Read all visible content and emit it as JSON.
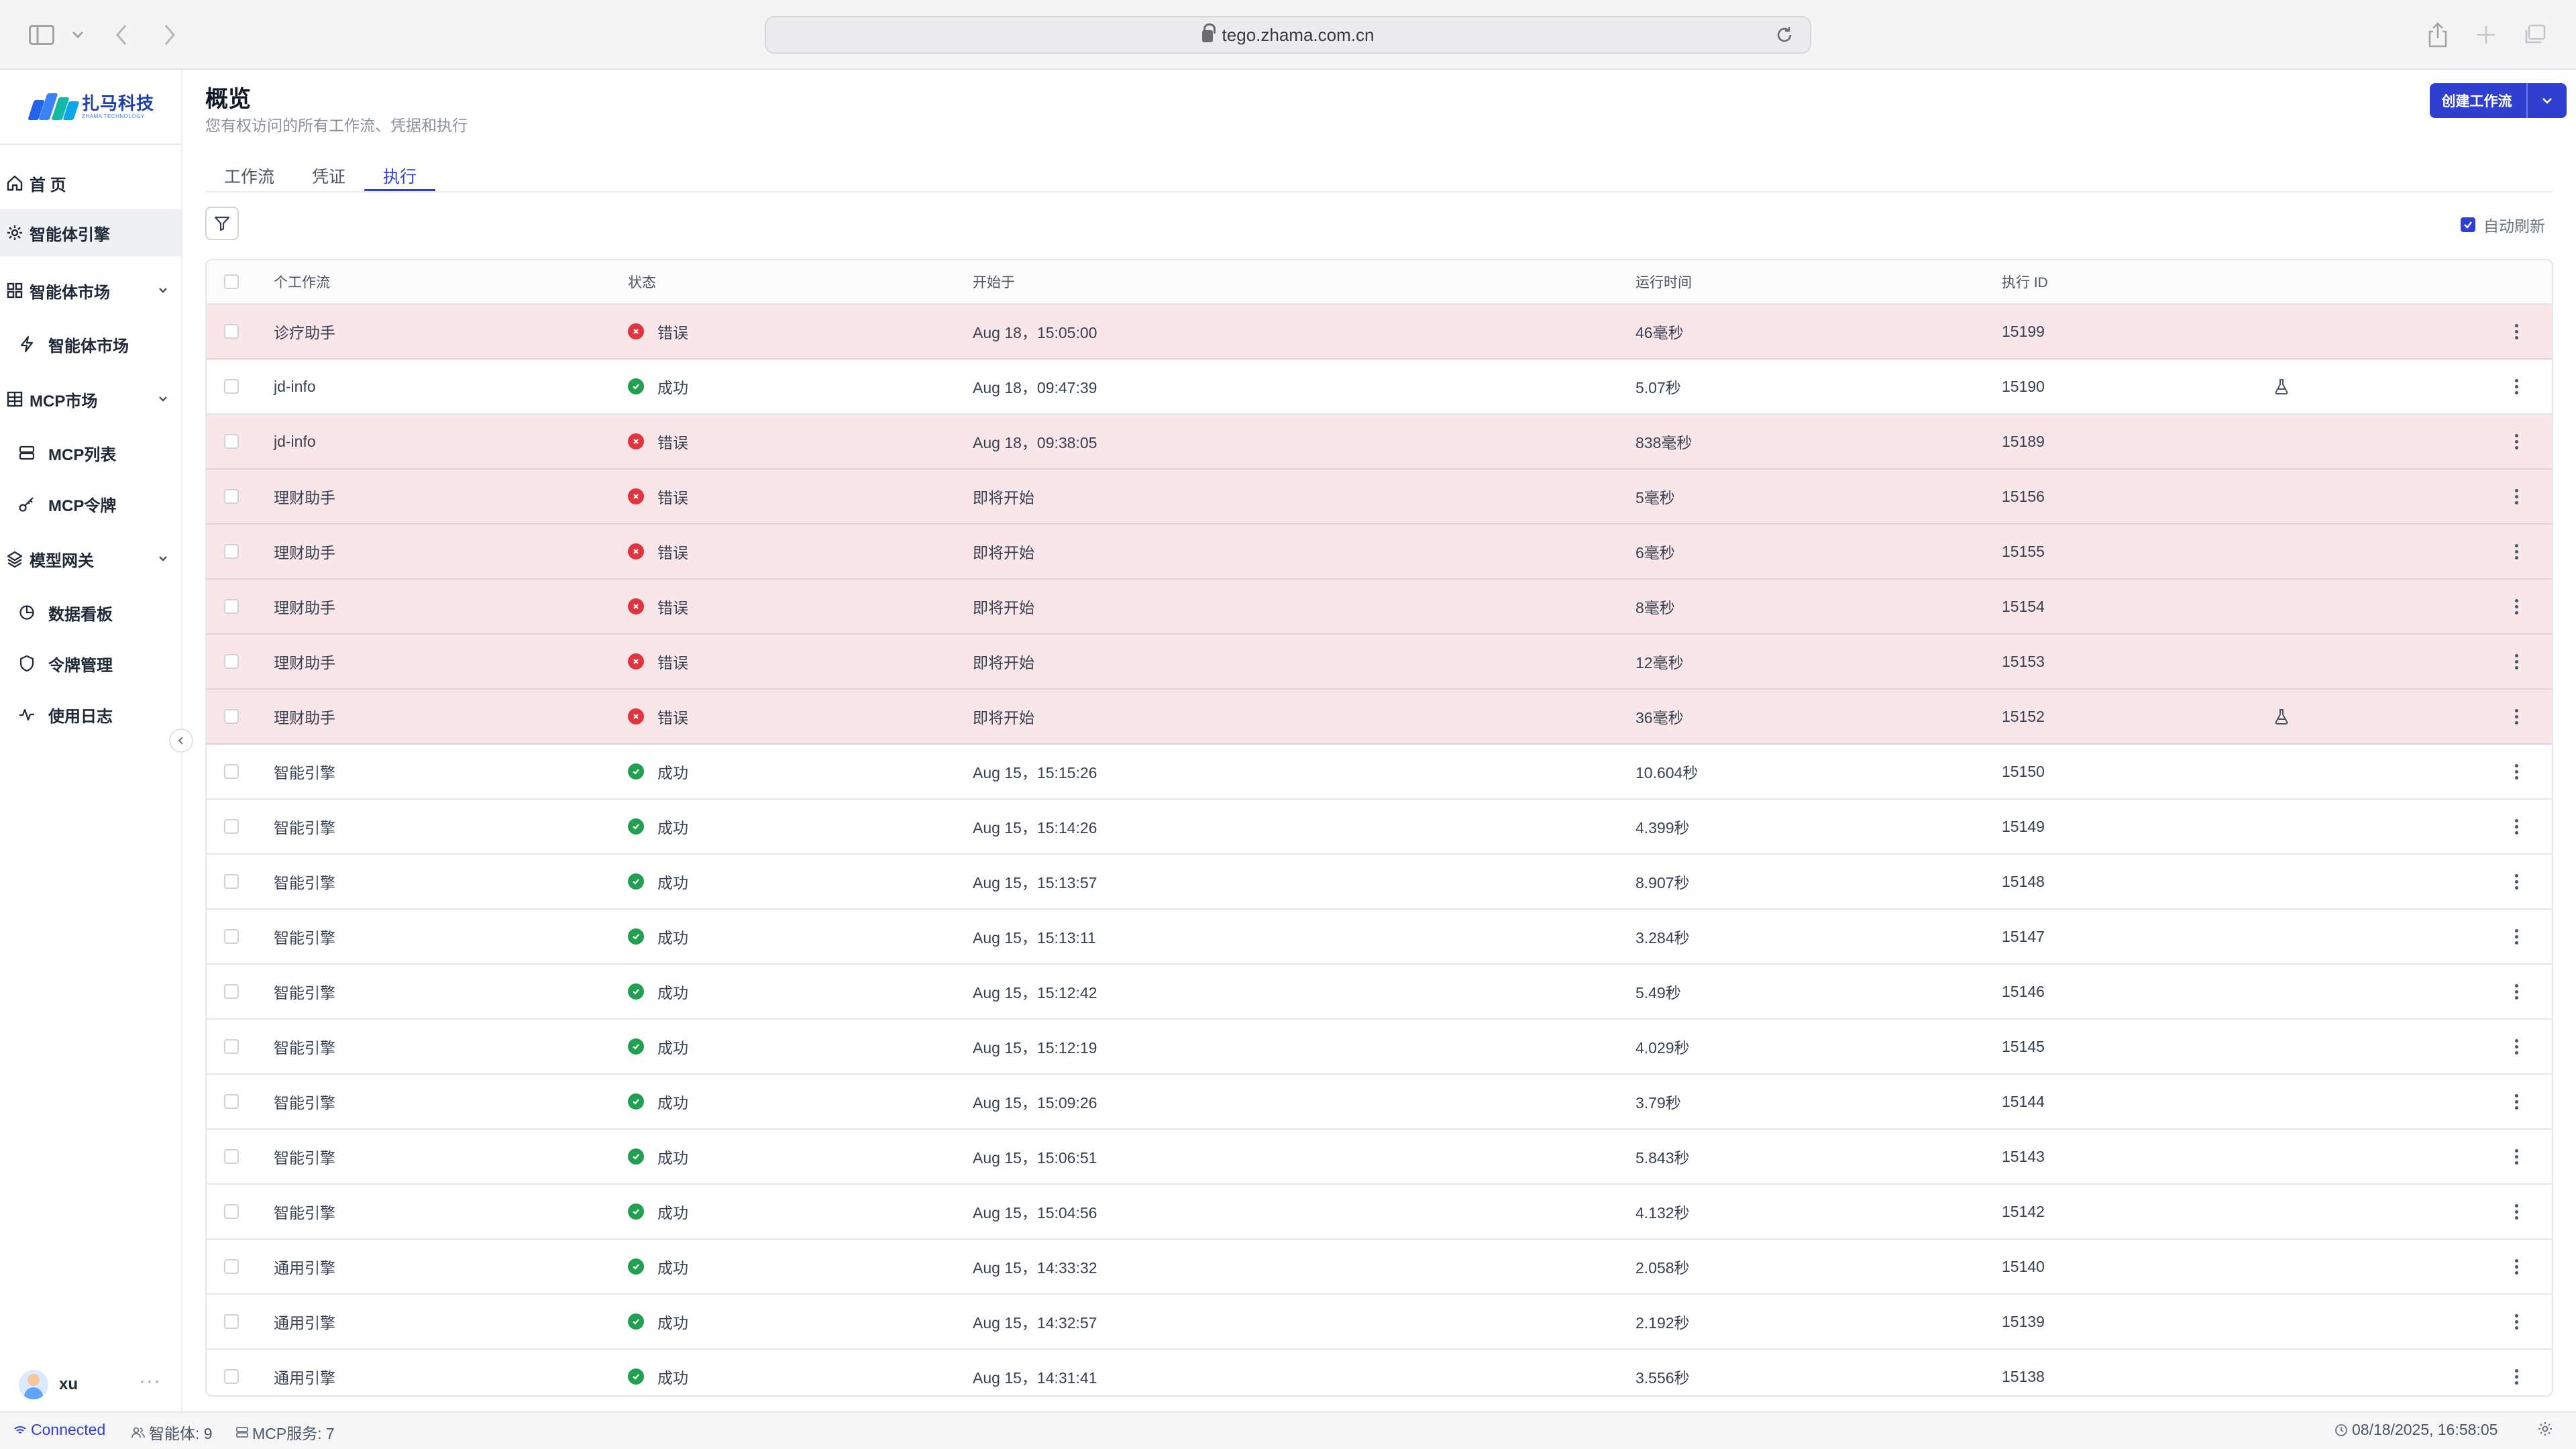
{
  "browser": {
    "url": "tego.zhama.com.cn"
  },
  "sidebar": {
    "logo_cn": "扎马科技",
    "logo_en": "ZHAMA TECHNOLOGY",
    "items": [
      {
        "label": "首 页",
        "icon": "home-icon"
      },
      {
        "label": "智能体引擎",
        "icon": "cube-gear-icon"
      },
      {
        "label": "智能体市场",
        "icon": "grid-icon"
      },
      {
        "label": "智能体市场",
        "icon": "lightning-icon"
      },
      {
        "label": "MCP市场",
        "icon": "building-icon"
      },
      {
        "label": "MCP列表",
        "icon": "server-icon"
      },
      {
        "label": "MCP令牌",
        "icon": "key-icon"
      },
      {
        "label": "模型网关",
        "icon": "layers-icon"
      },
      {
        "label": "数据看板",
        "icon": "pie-chart-icon"
      },
      {
        "label": "令牌管理",
        "icon": "shield-icon"
      },
      {
        "label": "使用日志",
        "icon": "activity-icon"
      }
    ],
    "user": {
      "name": "xu",
      "more": "···"
    }
  },
  "header": {
    "title": "概览",
    "subtitle": "您有权访问的所有工作流、凭据和执行",
    "create_button": "创建工作流"
  },
  "tabs": [
    {
      "label": "工作流",
      "active": false
    },
    {
      "label": "凭证",
      "active": false
    },
    {
      "label": "执行",
      "active": true
    }
  ],
  "toolbar": {
    "auto_refresh_label": "自动刷新",
    "auto_refresh_checked": true
  },
  "table": {
    "columns": [
      "个工作流",
      "状态",
      "开始于",
      "运行时间",
      "执行 ID"
    ],
    "rows": [
      {
        "workflow": "诊疗助手",
        "status": "错误",
        "ok": false,
        "started": "Aug 18，15:05:00",
        "runtime": "46毫秒",
        "id": "15199",
        "flask": false
      },
      {
        "workflow": "jd-info",
        "status": "成功",
        "ok": true,
        "started": "Aug 18，09:47:39",
        "runtime": "5.07秒",
        "id": "15190",
        "flask": true
      },
      {
        "workflow": "jd-info",
        "status": "错误",
        "ok": false,
        "started": "Aug 18，09:38:05",
        "runtime": "838毫秒",
        "id": "15189",
        "flask": false
      },
      {
        "workflow": "理财助手",
        "status": "错误",
        "ok": false,
        "started": "即将开始",
        "runtime": "5毫秒",
        "id": "15156",
        "flask": false
      },
      {
        "workflow": "理财助手",
        "status": "错误",
        "ok": false,
        "started": "即将开始",
        "runtime": "6毫秒",
        "id": "15155",
        "flask": false
      },
      {
        "workflow": "理财助手",
        "status": "错误",
        "ok": false,
        "started": "即将开始",
        "runtime": "8毫秒",
        "id": "15154",
        "flask": false
      },
      {
        "workflow": "理财助手",
        "status": "错误",
        "ok": false,
        "started": "即将开始",
        "runtime": "12毫秒",
        "id": "15153",
        "flask": false
      },
      {
        "workflow": "理财助手",
        "status": "错误",
        "ok": false,
        "started": "即将开始",
        "runtime": "36毫秒",
        "id": "15152",
        "flask": true
      },
      {
        "workflow": "智能引擎",
        "status": "成功",
        "ok": true,
        "started": "Aug 15，15:15:26",
        "runtime": "10.604秒",
        "id": "15150",
        "flask": false
      },
      {
        "workflow": "智能引擎",
        "status": "成功",
        "ok": true,
        "started": "Aug 15，15:14:26",
        "runtime": "4.399秒",
        "id": "15149",
        "flask": false
      },
      {
        "workflow": "智能引擎",
        "status": "成功",
        "ok": true,
        "started": "Aug 15，15:13:57",
        "runtime": "8.907秒",
        "id": "15148",
        "flask": false
      },
      {
        "workflow": "智能引擎",
        "status": "成功",
        "ok": true,
        "started": "Aug 15，15:13:11",
        "runtime": "3.284秒",
        "id": "15147",
        "flask": false
      },
      {
        "workflow": "智能引擎",
        "status": "成功",
        "ok": true,
        "started": "Aug 15，15:12:42",
        "runtime": "5.49秒",
        "id": "15146",
        "flask": false
      },
      {
        "workflow": "智能引擎",
        "status": "成功",
        "ok": true,
        "started": "Aug 15，15:12:19",
        "runtime": "4.029秒",
        "id": "15145",
        "flask": false
      },
      {
        "workflow": "智能引擎",
        "status": "成功",
        "ok": true,
        "started": "Aug 15，15:09:26",
        "runtime": "3.79秒",
        "id": "15144",
        "flask": false
      },
      {
        "workflow": "智能引擎",
        "status": "成功",
        "ok": true,
        "started": "Aug 15，15:06:51",
        "runtime": "5.843秒",
        "id": "15143",
        "flask": false
      },
      {
        "workflow": "智能引擎",
        "status": "成功",
        "ok": true,
        "started": "Aug 15，15:04:56",
        "runtime": "4.132秒",
        "id": "15142",
        "flask": false
      },
      {
        "workflow": "通用引擎",
        "status": "成功",
        "ok": true,
        "started": "Aug 15，14:33:32",
        "runtime": "2.058秒",
        "id": "15140",
        "flask": false
      },
      {
        "workflow": "通用引擎",
        "status": "成功",
        "ok": true,
        "started": "Aug 15，14:32:57",
        "runtime": "2.192秒",
        "id": "15139",
        "flask": false
      },
      {
        "workflow": "通用引擎",
        "status": "成功",
        "ok": true,
        "started": "Aug 15，14:31:41",
        "runtime": "3.556秒",
        "id": "15138",
        "flask": false
      }
    ]
  },
  "status_bar": {
    "connection": "Connected",
    "agents": "智能体: 9",
    "mcp": "MCP服务: 7",
    "datetime": "08/18/2025, 16:58:05"
  },
  "colors": {
    "accent": "#2f3fd0",
    "error_row": "#f8e6e8",
    "success": "#22a052",
    "error": "#e0343f"
  }
}
